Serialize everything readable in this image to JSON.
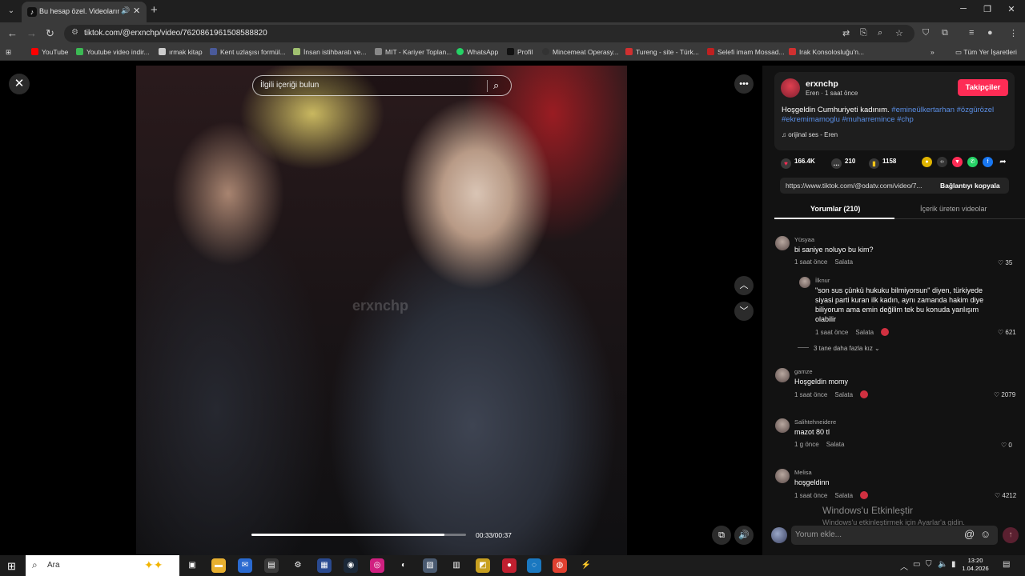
{
  "browser": {
    "tab_title": "Bu hesap özel. Videolarını g",
    "tab_favicon": "tiktok-icon",
    "new_tab_symbol": "+",
    "url": "tiktok.com/@erxnchp/video/7620861961508588820",
    "bookmarks": [
      {
        "label": "YouTube",
        "color": "#ff0000"
      },
      {
        "label": "Youtube video indir...",
        "color": "#3cba54"
      },
      {
        "label": "ırmak kitap",
        "color": "#cccccc"
      },
      {
        "label": "Kent uzlaşısı formül...",
        "color": "#4a5a9a"
      },
      {
        "label": "İnsan istihbaratı ve...",
        "color": "#a0c070"
      },
      {
        "label": "MIT - Kariyer Toplan...",
        "color": "#888888"
      },
      {
        "label": "WhatsApp",
        "color": "#25d366"
      },
      {
        "label": "Profil",
        "color": "#111111"
      },
      {
        "label": "Mincemeat Operasy...",
        "color": "#333333"
      },
      {
        "label": "Tureng - site - Türk...",
        "color": "#d03030"
      },
      {
        "label": "Selefi imam Mossad...",
        "color": "#c02020"
      },
      {
        "label": "Irak Konsolosluğu'n...",
        "color": "#d03030"
      }
    ],
    "all_bookmarks": "Tüm Yer İşaretleri",
    "more_bookmarks": "»"
  },
  "video": {
    "search_placeholder": "İlgili içeriği bulun",
    "watermark": "erxnchp",
    "time": "00:33/00:37",
    "progress": 0.9
  },
  "post": {
    "username": "erxnchp",
    "subline": "Eren · 1 saat önce",
    "follow_label": "Takipçiler",
    "caption_text": "Hoşgeldin Cumhuriyeti kadınım. ",
    "caption_tags": "#emineülkertarhan #özgürözel #ekremimamoglu #muharremince #chp",
    "music": "orijinal ses - Eren",
    "likes": "166.4K",
    "comments": "210",
    "saves": "1158",
    "link_url": "https://www.tiktok.com/@odatv.com/video/7...",
    "copy_label": "Bağlantıyı kopyala"
  },
  "tabs": {
    "comments": "Yorumlar (210)",
    "creator_videos": "İçerik üreten videolar"
  },
  "comments": [
    {
      "name": "Yüsyaa",
      "text": "bi saniye noluyo bu kim?",
      "time": "1 saat önce",
      "reply": "Salata",
      "likes": "35",
      "creator_liked": false
    },
    {
      "name": "İlknur",
      "text": "\"son sus çünkü hukuku bilmiyorsun\" diyen, türkiyede siyasi parti kuran ilk kadın, aynı zamanda hakim diye biliyorum ama emin değilim tek bu konuda yanlışım olabilir",
      "time": "1 saat önce",
      "reply": "Salata",
      "likes": "621",
      "creator_liked": true
    },
    {
      "name": "gamze",
      "text": "Hoşgeldin momy",
      "time": "1 saat önce",
      "reply": "Salata",
      "likes": "2079",
      "creator_liked": true
    },
    {
      "name": "Salihtehneidere",
      "text": "mazot 80 tl",
      "time": "1 g önce",
      "reply": "Salata",
      "likes": "0",
      "creator_liked": false
    },
    {
      "name": "Melisa",
      "text": "hoşgeldinn",
      "time": "1 saat önce",
      "reply": "Salata",
      "likes": "4212",
      "creator_liked": true
    }
  ],
  "more_replies": "3 tane daha fazla kız",
  "comment_box": {
    "placeholder": "Yorum ekle..."
  },
  "windows": {
    "activate_title": "Windows'u Etkinleştir",
    "activate_sub": "Windows'u etkinleştirmek için Ayarlar'a gidin.",
    "search": "Ara",
    "time": "13:20",
    "date": "1.04.2026"
  },
  "colors": {
    "accent": "#fe2c55",
    "hashtag": "#5b8fe6"
  }
}
